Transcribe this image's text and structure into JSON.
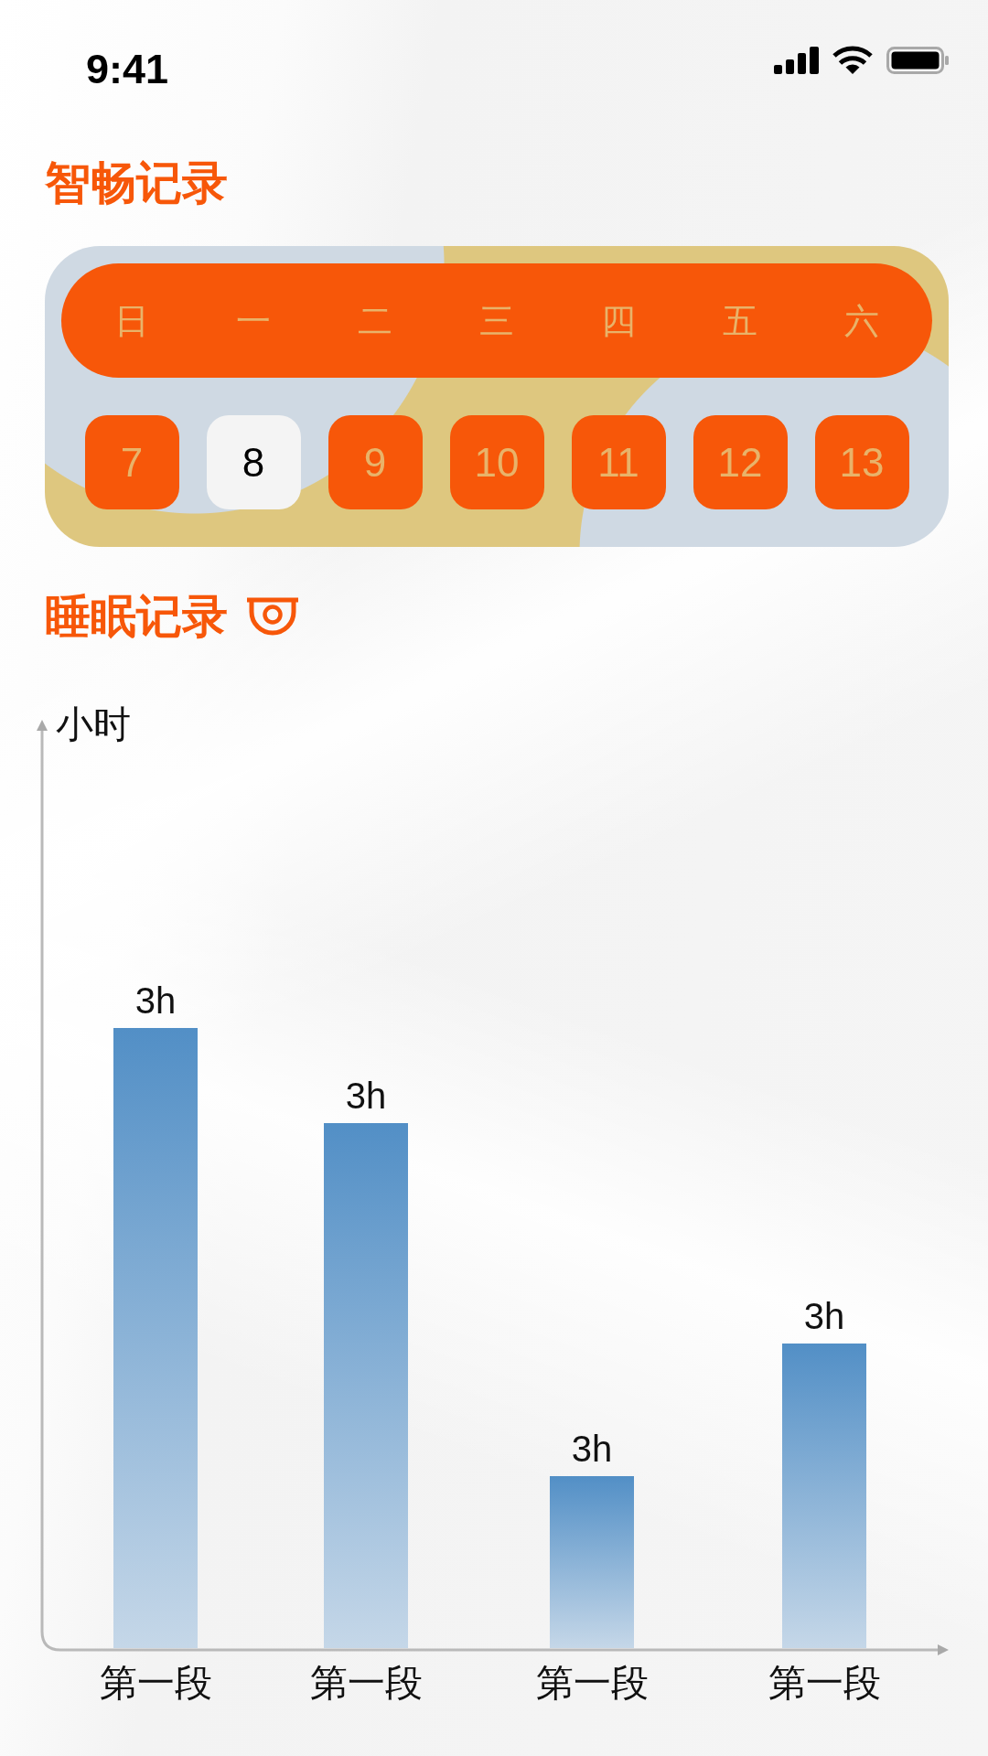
{
  "status_bar": {
    "time": "9:41"
  },
  "record_section": {
    "title": "智畅记录"
  },
  "calendar": {
    "weekdays": [
      "日",
      "一",
      "二",
      "三",
      "四",
      "五",
      "六"
    ],
    "days": [
      {
        "label": "7",
        "selected": false
      },
      {
        "label": "8",
        "selected": true
      },
      {
        "label": "9",
        "selected": false
      },
      {
        "label": "10",
        "selected": false
      },
      {
        "label": "11",
        "selected": false
      },
      {
        "label": "12",
        "selected": false
      },
      {
        "label": "13",
        "selected": false
      }
    ]
  },
  "sleep_section": {
    "title": "睡眠记录"
  },
  "sleep_chart": {
    "y_axis_label": "小时",
    "bars": [
      {
        "category": "第一段",
        "value_label": "3h"
      },
      {
        "category": "第一段",
        "value_label": "3h"
      },
      {
        "category": "第一段",
        "value_label": "3h"
      },
      {
        "category": "第一段",
        "value_label": "3h"
      }
    ]
  }
}
